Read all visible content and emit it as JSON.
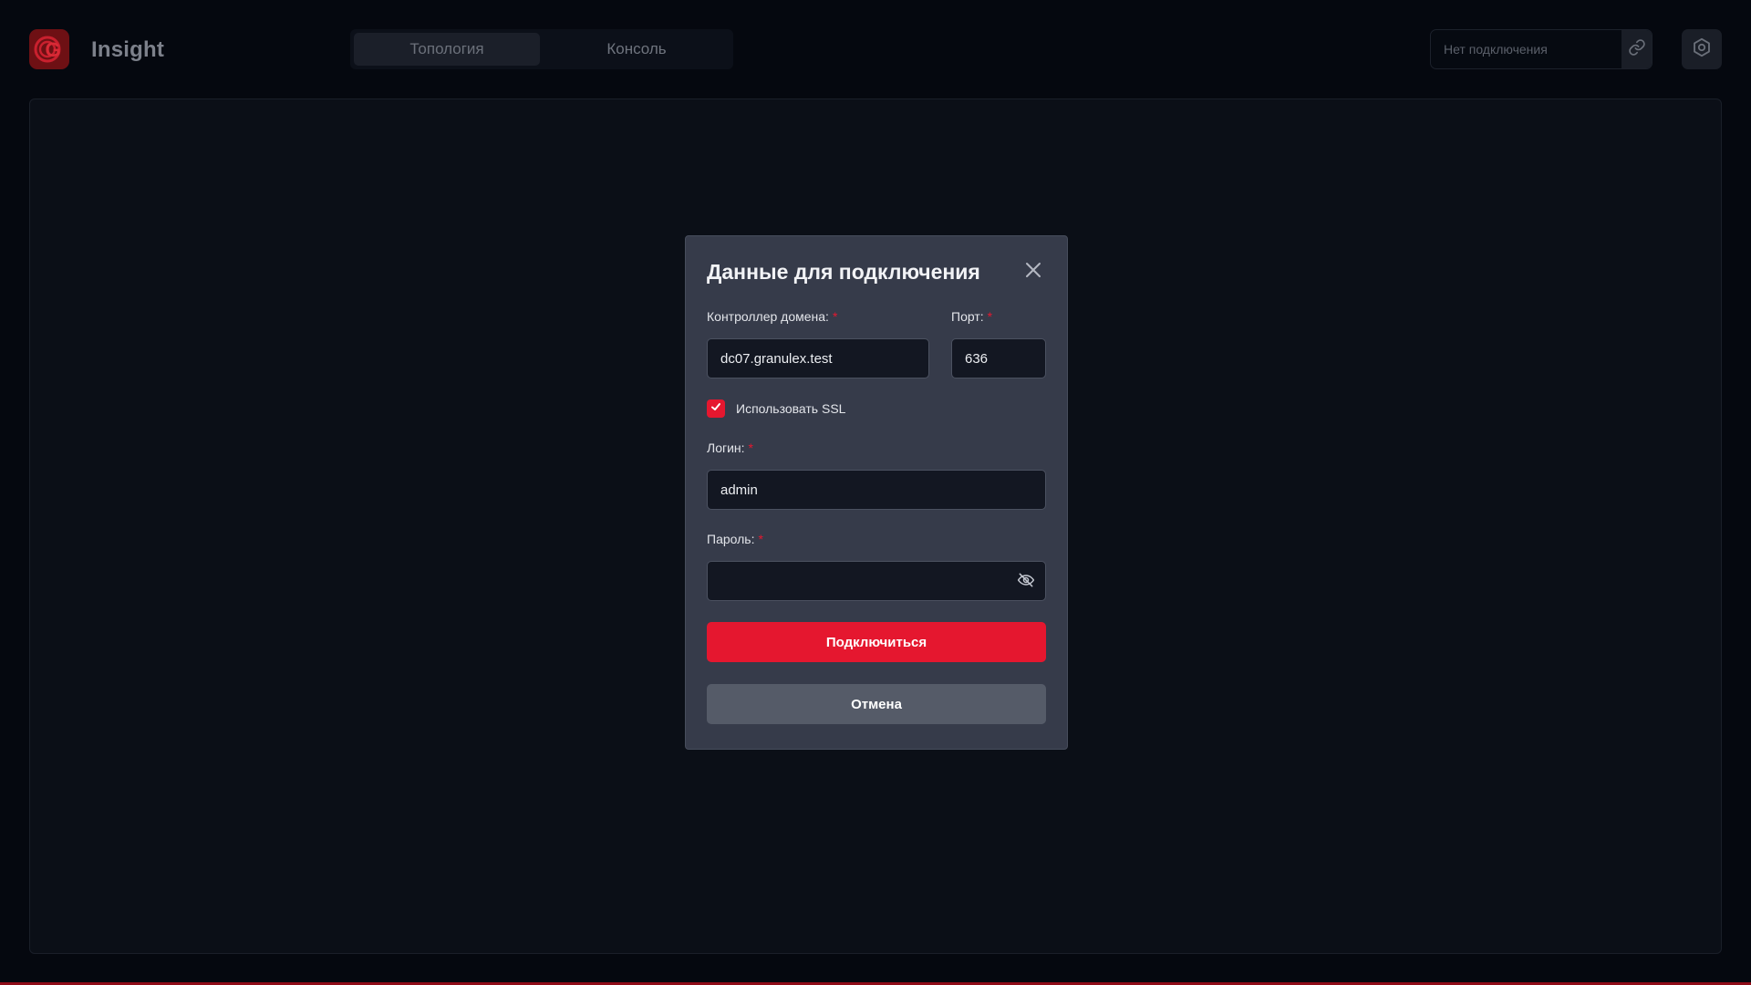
{
  "app": {
    "name": "Insight",
    "logo_letter": "G"
  },
  "tabs": [
    {
      "label": "Топология",
      "active": true
    },
    {
      "label": "Консоль",
      "active": false
    }
  ],
  "connection": {
    "placeholder": "Нет подключения",
    "link_icon": "link-icon",
    "settings_icon": "settings-icon"
  },
  "modal": {
    "title": "Данные для подключения",
    "domain_controller": {
      "label": "Контроллер домена:",
      "value": "dc07.granulex.test"
    },
    "port": {
      "label": "Порт:",
      "value": "636"
    },
    "ssl": {
      "label": "Использовать SSL",
      "checked": true
    },
    "login": {
      "label": "Логин:",
      "value": "admin"
    },
    "password": {
      "label": "Пароль:",
      "value": ""
    },
    "required_mark": "*",
    "connect_label": "Подключиться",
    "cancel_label": "Отмена"
  },
  "colors": {
    "accent": "#e5172f",
    "background": "#05080f",
    "modal": "#363b4a"
  }
}
